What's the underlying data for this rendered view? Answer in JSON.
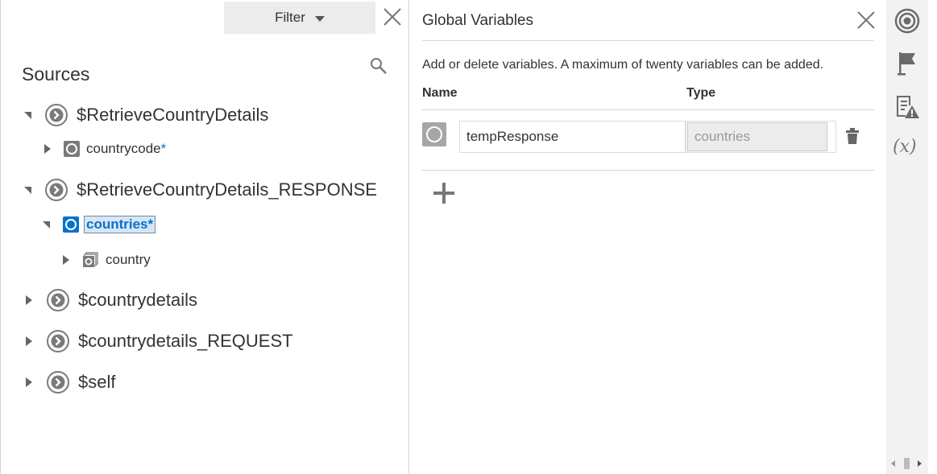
{
  "left": {
    "filter_label": "Filter",
    "sources_title": "Sources",
    "tree": [
      {
        "label": "$RetrieveCountryDetails",
        "expanded": true,
        "children": [
          {
            "label": "countrycode",
            "required": "*"
          }
        ]
      },
      {
        "label": "$RetrieveCountryDetails_RESPONSE",
        "expanded": true,
        "children": [
          {
            "label": "countries",
            "required": "*",
            "selected": true,
            "children": [
              {
                "label": "country"
              }
            ]
          }
        ]
      },
      {
        "label": "$countrydetails",
        "expanded": false
      },
      {
        "label": "$countrydetails_REQUEST",
        "expanded": false
      },
      {
        "label": "$self",
        "expanded": false
      }
    ]
  },
  "globals": {
    "title": "Global Variables",
    "description": "Add or delete variables. A maximum of twenty variables can be added.",
    "col_name": "Name",
    "col_type": "Type",
    "rows": [
      {
        "name": "tempResponse",
        "type": "countries"
      }
    ]
  },
  "toolbar": {
    "icons": [
      "target-icon",
      "flag-icon",
      "validation-warning-icon",
      "variables-icon"
    ],
    "fx_label": "(x)"
  },
  "colors": {
    "accent": "#0572ce",
    "selection_bg": "#d8e6f3",
    "toolbar_bg": "#f2f2f2"
  }
}
